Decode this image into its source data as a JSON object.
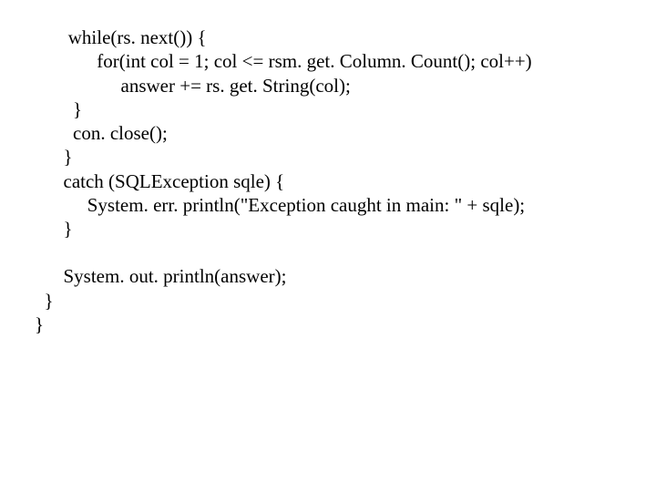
{
  "code": {
    "l1": "       while(rs. next()) {",
    "l2": "             for(int col = 1; col <= rsm. get. Column. Count(); col++)",
    "l3": "                  answer += rs. get. String(col);",
    "l4": "        }",
    "l5": "        con. close();",
    "l6": "      }",
    "l7": "      catch (SQLException sqle) {",
    "l8": "           System. err. println(\"Exception caught in main: \" + sqle);",
    "l9": "      }",
    "l10": "      System. out. println(answer);",
    "l11": "  }",
    "l12": "}"
  }
}
